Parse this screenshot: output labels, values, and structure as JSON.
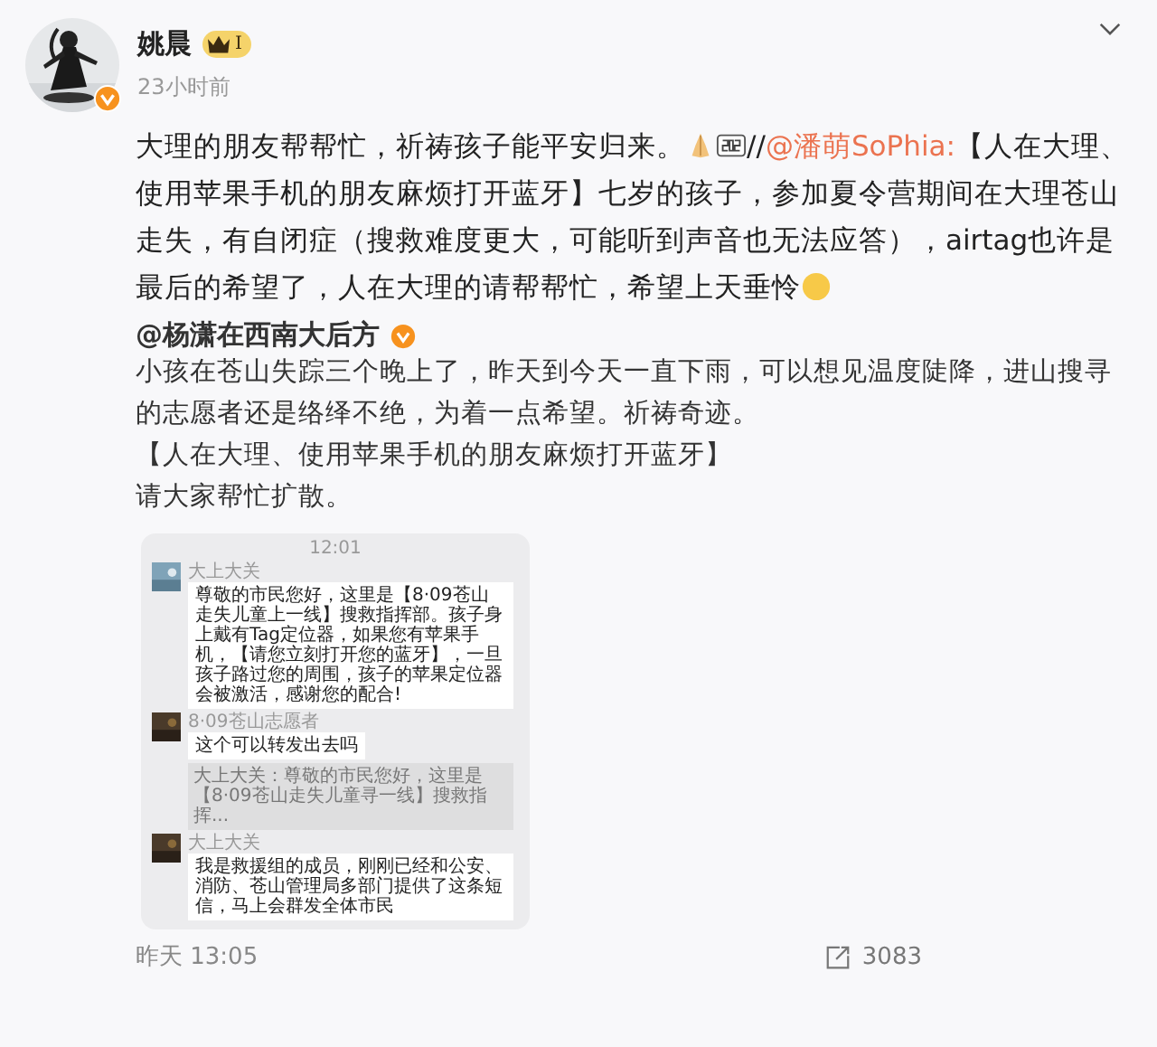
{
  "post": {
    "author": "姚晨",
    "member_badge": "I",
    "time": "23小时前",
    "text_before": "大理的朋友帮帮忙，祈祷孩子能平安归来。",
    "separator": "//",
    "mention": "@潘萌SoPhia:",
    "text_after": "【人在大理、使用苹果手机的朋友麻烦打开蓝牙】七岁的孩子，参加夏令营期间在大理苍山走失，有自闭症（搜救难度更大，可能听到声音也无法应答），airtag也许是最后的希望了，人在大理的请帮帮忙，希望上天垂怜"
  },
  "repost": {
    "author": "@杨潇在西南大后方",
    "paragraphs": [
      "小孩在苍山失踪三个晚上了，昨天到今天一直下雨，可以想见温度陡降，进山搜寻的志愿者还是络绎不绝，为着一点希望。祈祷奇迹。",
      "【人在大理、使用苹果手机的朋友麻烦打开蓝牙】",
      "请大家帮忙扩散。"
    ],
    "chat_screenshot": {
      "time": "12:01",
      "messages": [
        {
          "kind": "text",
          "sender": "大上大关",
          "text": "尊敬的市民您好，这里是【8·09苍山走失儿童上一线】搜救指挥部。孩子身上戴有Tag定位器，如果您有苹果手机，【请您立刻打开您的蓝牙】，一旦孩子路过您的周围，孩子的苹果定位器会被激活，感谢您的配合!"
        },
        {
          "kind": "text",
          "sender": "8·09苍山志愿者",
          "text": "这个可以转发出去吗"
        },
        {
          "kind": "quote",
          "text": "大上大关：尊敬的市民您好，这里是【8·09苍山走失儿童寻一线】搜救指挥..."
        },
        {
          "kind": "text",
          "sender": "大上大关",
          "text": "我是救援组的成员，刚刚已经和公安、消防、苍山管理局多部门提供了这条短信，马上会群发全体市民"
        }
      ]
    },
    "time": "昨天 13:05",
    "share_count": "3083"
  }
}
